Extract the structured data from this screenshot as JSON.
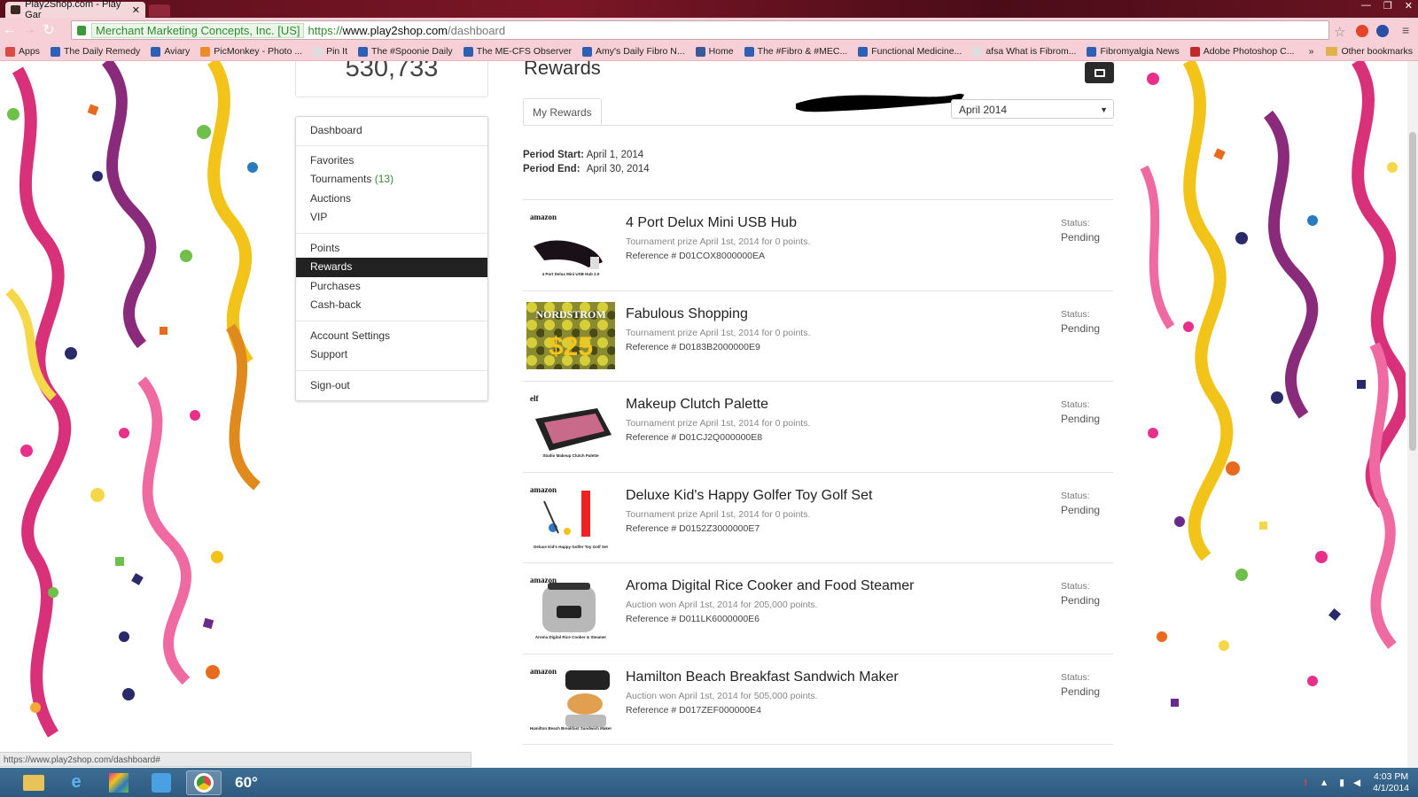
{
  "browser": {
    "tab_title": "Play2Shop.com - Play Gar",
    "ev_cert": "Merchant Marketing Concepts, Inc. [US]",
    "url_proto": "https://",
    "url_host": "www.play2shop.com",
    "url_path": "/dashboard",
    "bookmarks": [
      {
        "label": "Apps",
        "color": "#d94b4b"
      },
      {
        "label": "The Daily Remedy",
        "color": "#2e5fb3"
      },
      {
        "label": "Aviary",
        "color": "#2e5fb3"
      },
      {
        "label": "PicMonkey - Photo ...",
        "color": "#e98c2a"
      },
      {
        "label": "Pin It",
        "color": "#dddddd"
      },
      {
        "label": "The #Spoonie Daily",
        "color": "#2e5fb3"
      },
      {
        "label": "The ME-CFS Observer",
        "color": "#2e5fb3"
      },
      {
        "label": "Amy's Daily Fibro N...",
        "color": "#2e5fb3"
      },
      {
        "label": "Home",
        "color": "#3b5998"
      },
      {
        "label": "The #Fibro & #MEC...",
        "color": "#2e5fb3"
      },
      {
        "label": "Functional Medicine...",
        "color": "#2e5fb3"
      },
      {
        "label": "afsa What is Fibrom...",
        "color": "#dddddd"
      },
      {
        "label": "Fibromyalgia News",
        "color": "#2e5fb3"
      },
      {
        "label": "Adobe Photoshop C...",
        "color": "#c02a2a"
      }
    ],
    "more_bookmarks": "»",
    "other_bookmarks": "Other bookmarks",
    "status_url": "https://www.play2shop.com/dashboard#"
  },
  "points_total": "530,733",
  "nav": {
    "dashboard": "Dashboard",
    "favorites": "Favorites",
    "tournaments": "Tournaments",
    "tournaments_count": "(13)",
    "auctions": "Auctions",
    "vip": "VIP",
    "points": "Points",
    "rewards": "Rewards",
    "purchases": "Purchases",
    "cashback": "Cash-back",
    "account_settings": "Account Settings",
    "support": "Support",
    "signout": "Sign-out"
  },
  "rewards": {
    "title": "Rewards",
    "tab_label": "My Rewards",
    "period_selected": "April 2014",
    "period_start_label": "Period Start:",
    "period_start": "April 1, 2014",
    "period_end_label": "Period End:",
    "period_end": "April 30, 2014",
    "status_label": "Status:",
    "reference_prefix": "Reference #",
    "items": [
      {
        "title": "4 Port Delux Mini USB Hub",
        "subtitle": "Tournament prize April 1st, 2014 for 0 points.",
        "reference": "D01COX8000000EA",
        "status": "Pending",
        "brand": "amazon",
        "caption": "4 Port Delux Mini USB Hub 2.0"
      },
      {
        "title": "Fabulous Shopping",
        "subtitle": "Tournament prize April 1st, 2014 for 0 points.",
        "reference": "D0183B2000000E9",
        "status": "Pending",
        "brand": "NORDSTROM",
        "caption": "$25"
      },
      {
        "title": "Makeup Clutch Palette",
        "subtitle": "Tournament prize April 1st, 2014 for 0 points.",
        "reference": "D01CJ2Q000000E8",
        "status": "Pending",
        "brand": "elf",
        "caption": "Studio Makeup Clutch Palette"
      },
      {
        "title": "Deluxe Kid's Happy Golfer Toy Golf Set",
        "subtitle": "Tournament prize April 1st, 2014 for 0 points.",
        "reference": "D0152Z3000000E7",
        "status": "Pending",
        "brand": "amazon",
        "caption": "Deluxe Kid's Happy Golfer Toy Golf Set"
      },
      {
        "title": "Aroma Digital Rice Cooker and Food Steamer",
        "subtitle": "Auction won April 1st, 2014 for 205,000 points.",
        "reference": "D011LK6000000E6",
        "status": "Pending",
        "brand": "amazon",
        "caption": "Aroma Digital Rice Cooker & Steamer"
      },
      {
        "title": "Hamilton Beach Breakfast Sandwich Maker",
        "subtitle": "Auction won April 1st, 2014 for 505,000 points.",
        "reference": "D017ZEF000000E4",
        "status": "Pending",
        "brand": "amazon",
        "caption": "Hamilton Beach Breakfast Sandwich Maker"
      }
    ]
  },
  "taskbar": {
    "weather": "60°",
    "time": "4:03 PM",
    "date": "4/1/2014"
  }
}
